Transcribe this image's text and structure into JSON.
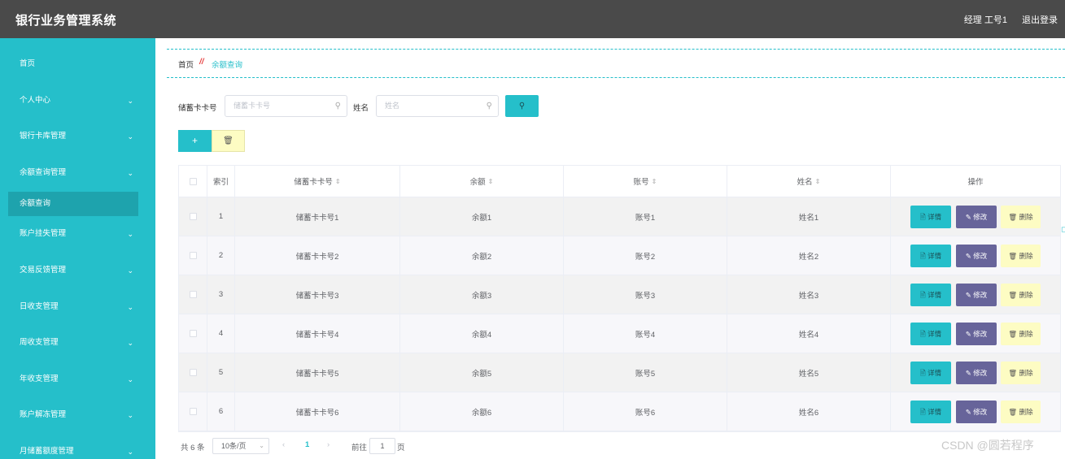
{
  "header": {
    "title": "银行业务管理系统",
    "user": "经理 工号1",
    "logout": "退出登录"
  },
  "sidebar": {
    "items": [
      {
        "label": "首页",
        "chevron": ""
      },
      {
        "label": "个人中心",
        "chevron": "⌄"
      },
      {
        "label": "银行卡库管理",
        "chevron": "⌄"
      },
      {
        "label": "余额查询管理",
        "chevron": "⌄"
      },
      {
        "label": "余额查询",
        "chevron": ""
      },
      {
        "label": "账户挂失管理",
        "chevron": "⌄"
      },
      {
        "label": "交易反馈管理",
        "chevron": "⌄"
      },
      {
        "label": "日收支管理",
        "chevron": "⌄"
      },
      {
        "label": "周收支管理",
        "chevron": "⌄"
      },
      {
        "label": "年收支管理",
        "chevron": "⌄"
      },
      {
        "label": "账户解冻管理",
        "chevron": "⌄"
      },
      {
        "label": "月储蓄额度管理",
        "chevron": "⌄"
      }
    ]
  },
  "breadcrumb": {
    "home": "首页",
    "separator": "//",
    "current": "余额查询"
  },
  "search": {
    "card_label": "储蓄卡卡号",
    "card_placeholder": "储蓄卡卡号",
    "name_label": "姓名",
    "name_placeholder": "姓名",
    "search_icon": "search-icon"
  },
  "toolbar": {
    "add_label": "+",
    "delete_icon": "🗑"
  },
  "table": {
    "columns": [
      "索引",
      "储蓄卡卡号",
      "余额",
      "账号",
      "姓名",
      "操作"
    ],
    "sort_glyph": "⇕",
    "rows": [
      {
        "index": "1",
        "card": "储蓄卡卡号1",
        "balance": "余额1",
        "account": "账号1",
        "name": "姓名1"
      },
      {
        "index": "2",
        "card": "储蓄卡卡号2",
        "balance": "余额2",
        "account": "账号2",
        "name": "姓名2"
      },
      {
        "index": "3",
        "card": "储蓄卡卡号3",
        "balance": "余额3",
        "account": "账号3",
        "name": "姓名3"
      },
      {
        "index": "4",
        "card": "储蓄卡卡号4",
        "balance": "余额4",
        "account": "账号4",
        "name": "姓名4"
      },
      {
        "index": "5",
        "card": "储蓄卡卡号5",
        "balance": "余额5",
        "account": "账号5",
        "name": "姓名5"
      },
      {
        "index": "6",
        "card": "储蓄卡卡号6",
        "balance": "余额6",
        "account": "账号6",
        "name": "姓名6"
      }
    ],
    "actions": {
      "detail": "🗎 详情",
      "edit": "✎ 修改",
      "delete": "🗑 删除"
    }
  },
  "pagination": {
    "total": "共 6 条",
    "page_size": "10条/页",
    "prev": "‹",
    "current_page": "1",
    "next": "›",
    "goto_label": "前往",
    "goto_value": "1",
    "page_suffix": "页"
  },
  "watermark": "CSDN @圆若程序",
  "colors": {
    "accent": "#25bfca",
    "header_bg": "#4a4a4a",
    "edit_btn": "#67649a",
    "delete_btn": "#fdfcc3"
  }
}
